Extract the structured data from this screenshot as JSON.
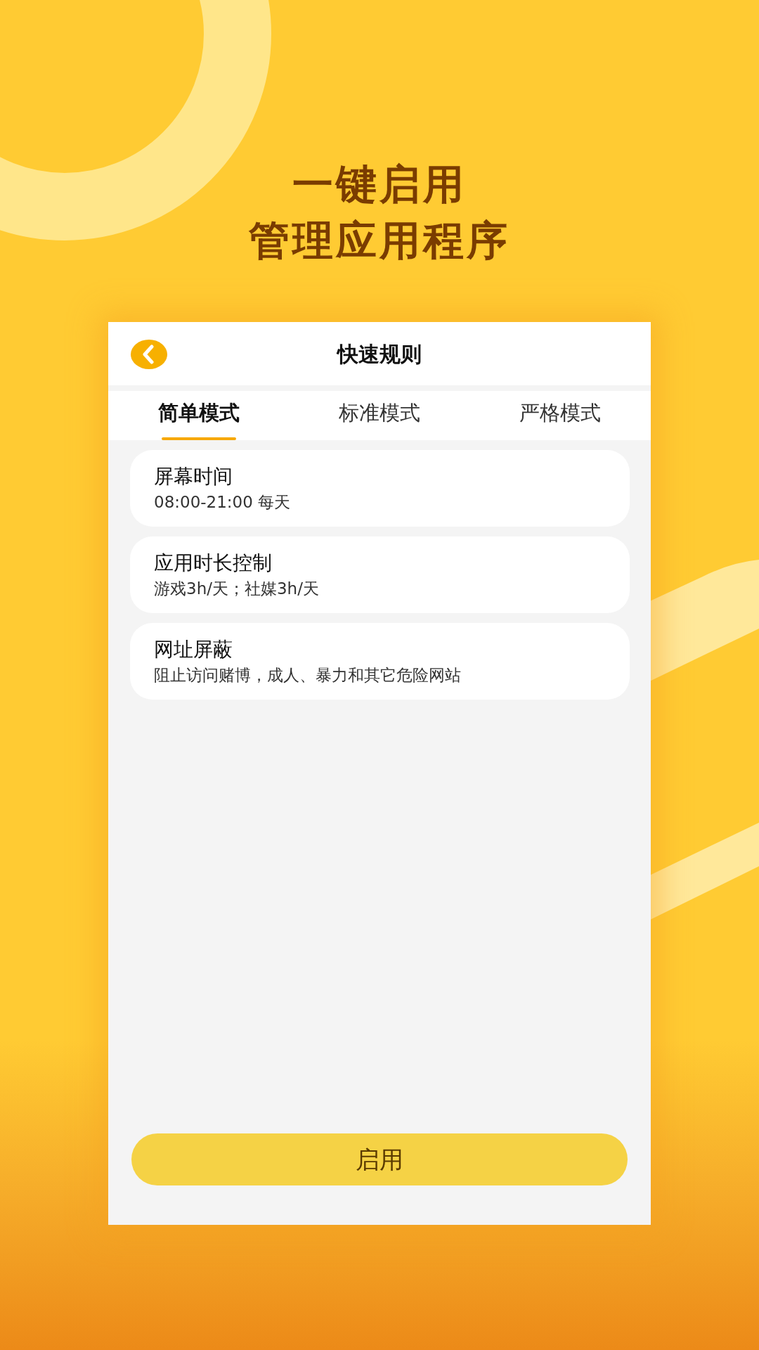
{
  "headline": [
    "一键启用",
    "管理应用程序"
  ],
  "screen": {
    "title": "快速规则",
    "tabs": [
      {
        "label": "简单模式",
        "selected": true
      },
      {
        "label": "标准模式",
        "selected": false
      },
      {
        "label": "严格模式",
        "selected": false
      }
    ],
    "rules": [
      {
        "title": "屏幕时间",
        "detail": "08:00-21:00 每天"
      },
      {
        "title": "应用时长控制",
        "detail": "游戏3h/天；社媒3h/天"
      },
      {
        "title": "网址屏蔽",
        "detail": "阻止访问赌博，成人、暴力和其它危险网站"
      }
    ],
    "button": "启用"
  }
}
